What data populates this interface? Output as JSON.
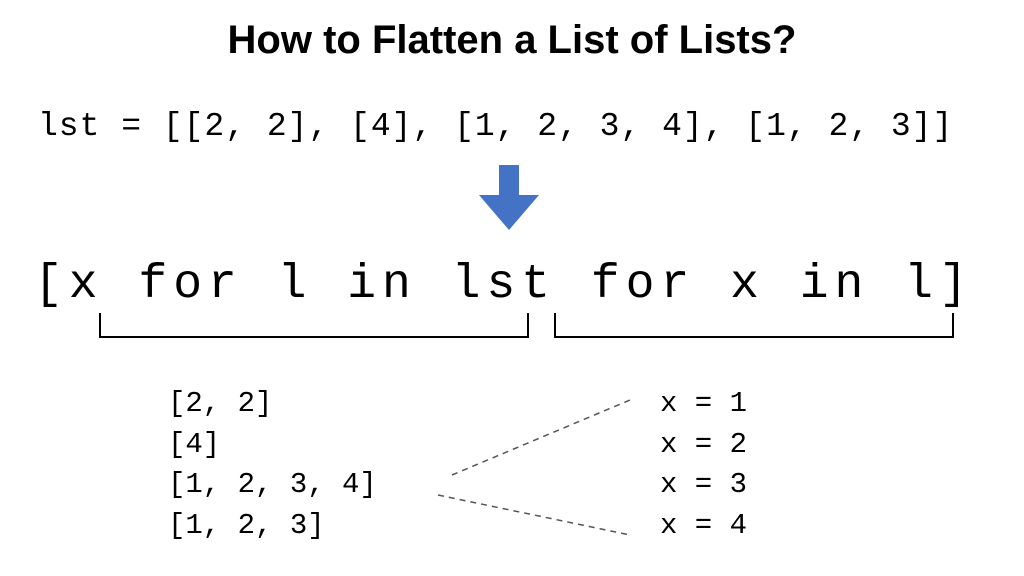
{
  "title": "How to Flatten a List of Lists?",
  "declaration": "lst = [[2, 2], [4], [1, 2, 3, 4], [1, 2, 3]]",
  "comprehension": "[x for l in lst for x in l]",
  "sublists_text": "[2, 2]\n[4]\n[1, 2, 3, 4]\n[1, 2, 3]",
  "assignments_text": "x = 1\nx = 2\nx = 3\nx = 4",
  "arrow_color": "#4472C4",
  "chart_data": {
    "type": "diagram",
    "concept": "Python nested list comprehension flattening",
    "input_variable": "lst",
    "input_value": [
      [
        2,
        2
      ],
      [
        4
      ],
      [
        1,
        2,
        3,
        4
      ],
      [
        1,
        2,
        3
      ]
    ],
    "expression": "[x for l in lst for x in l]",
    "outer_loop": "for l in lst",
    "inner_loop": "for x in l",
    "outer_yields": [
      "[2, 2]",
      "[4]",
      "[1, 2, 3, 4]",
      "[1, 2, 3]"
    ],
    "inner_example_source": "[1, 2, 3, 4]",
    "inner_example_yields": [
      "x = 1",
      "x = 2",
      "x = 3",
      "x = 4"
    ]
  }
}
